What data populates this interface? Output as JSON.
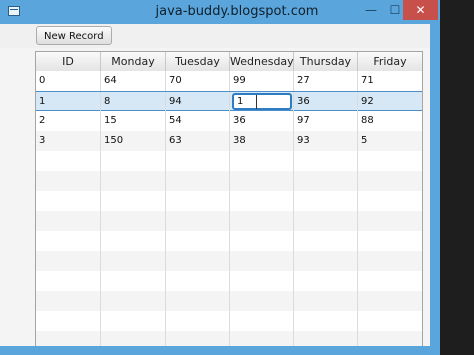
{
  "window": {
    "title": "java-buddy.blogspot.com",
    "minimize_glyph": "—",
    "maximize_glyph": "☐",
    "close_glyph": "✕",
    "accent": "#5aa6dc",
    "close_color": "#c7504a"
  },
  "toolbar": {
    "new_record_label": "New Record"
  },
  "table": {
    "columns": [
      "ID",
      "Monday",
      "Tuesday",
      "Wednesday",
      "Thursday",
      "Friday"
    ],
    "rows": [
      [
        "0",
        "64",
        "70",
        "99",
        "27",
        "71"
      ],
      [
        "1",
        "8",
        "94",
        "1",
        "36",
        "92"
      ],
      [
        "2",
        "15",
        "54",
        "36",
        "97",
        "88"
      ],
      [
        "3",
        "150",
        "63",
        "38",
        "93",
        "5"
      ]
    ],
    "selected_row": 1,
    "editing_cell": {
      "row": 1,
      "column": "Wednesday",
      "value": "1"
    },
    "selection_color": "#d6e8f6"
  }
}
